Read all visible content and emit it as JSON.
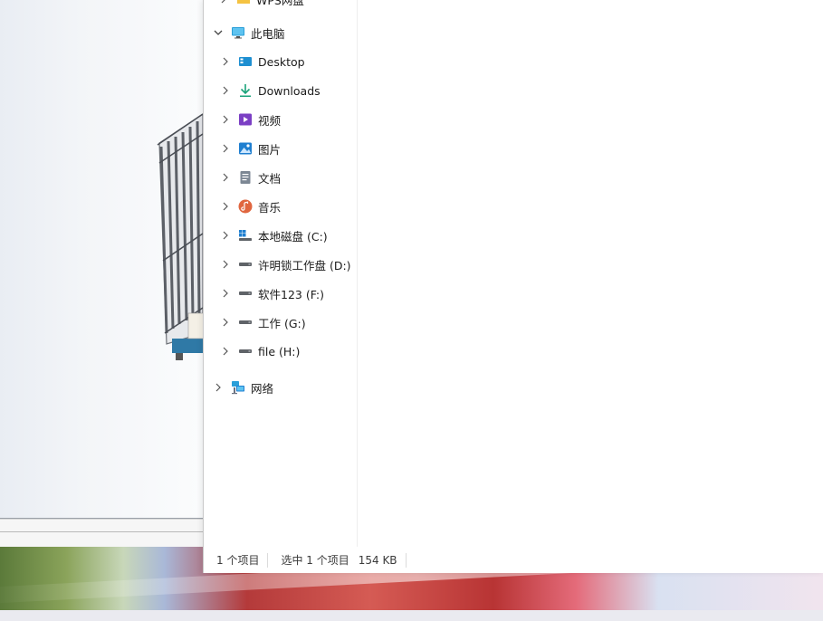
{
  "nav_tree": {
    "top_partial": {
      "label": "WPS网盘"
    },
    "this_pc": {
      "label": "此电脑",
      "icon": "monitor-icon",
      "expanded": true
    },
    "items": [
      {
        "label": "Desktop",
        "icon": "desktop-icon"
      },
      {
        "label": "Downloads",
        "icon": "download-icon"
      },
      {
        "label": "视频",
        "icon": "video-icon"
      },
      {
        "label": "图片",
        "icon": "pictures-icon"
      },
      {
        "label": "文档",
        "icon": "document-icon"
      },
      {
        "label": "音乐",
        "icon": "music-icon"
      },
      {
        "label": "本地磁盘 (C:)",
        "icon": "windows-drive-icon"
      },
      {
        "label": "许明锁工作盘 (D:)",
        "icon": "drive-icon"
      },
      {
        "label": "软件123 (F:)",
        "icon": "drive-icon"
      },
      {
        "label": "工作 (G:)",
        "icon": "drive-icon"
      },
      {
        "label": "file (H:)",
        "icon": "drive-icon"
      }
    ],
    "network": {
      "label": "网络",
      "icon": "network-icon"
    }
  },
  "status_bar": {
    "item_count": "1 个项目",
    "selected": "选中 1 个项目",
    "size": "154 KB"
  },
  "colors": {
    "accent": "#0078d4",
    "drive_gray": "#5f6368",
    "folder_yellow": "#f5c342"
  }
}
